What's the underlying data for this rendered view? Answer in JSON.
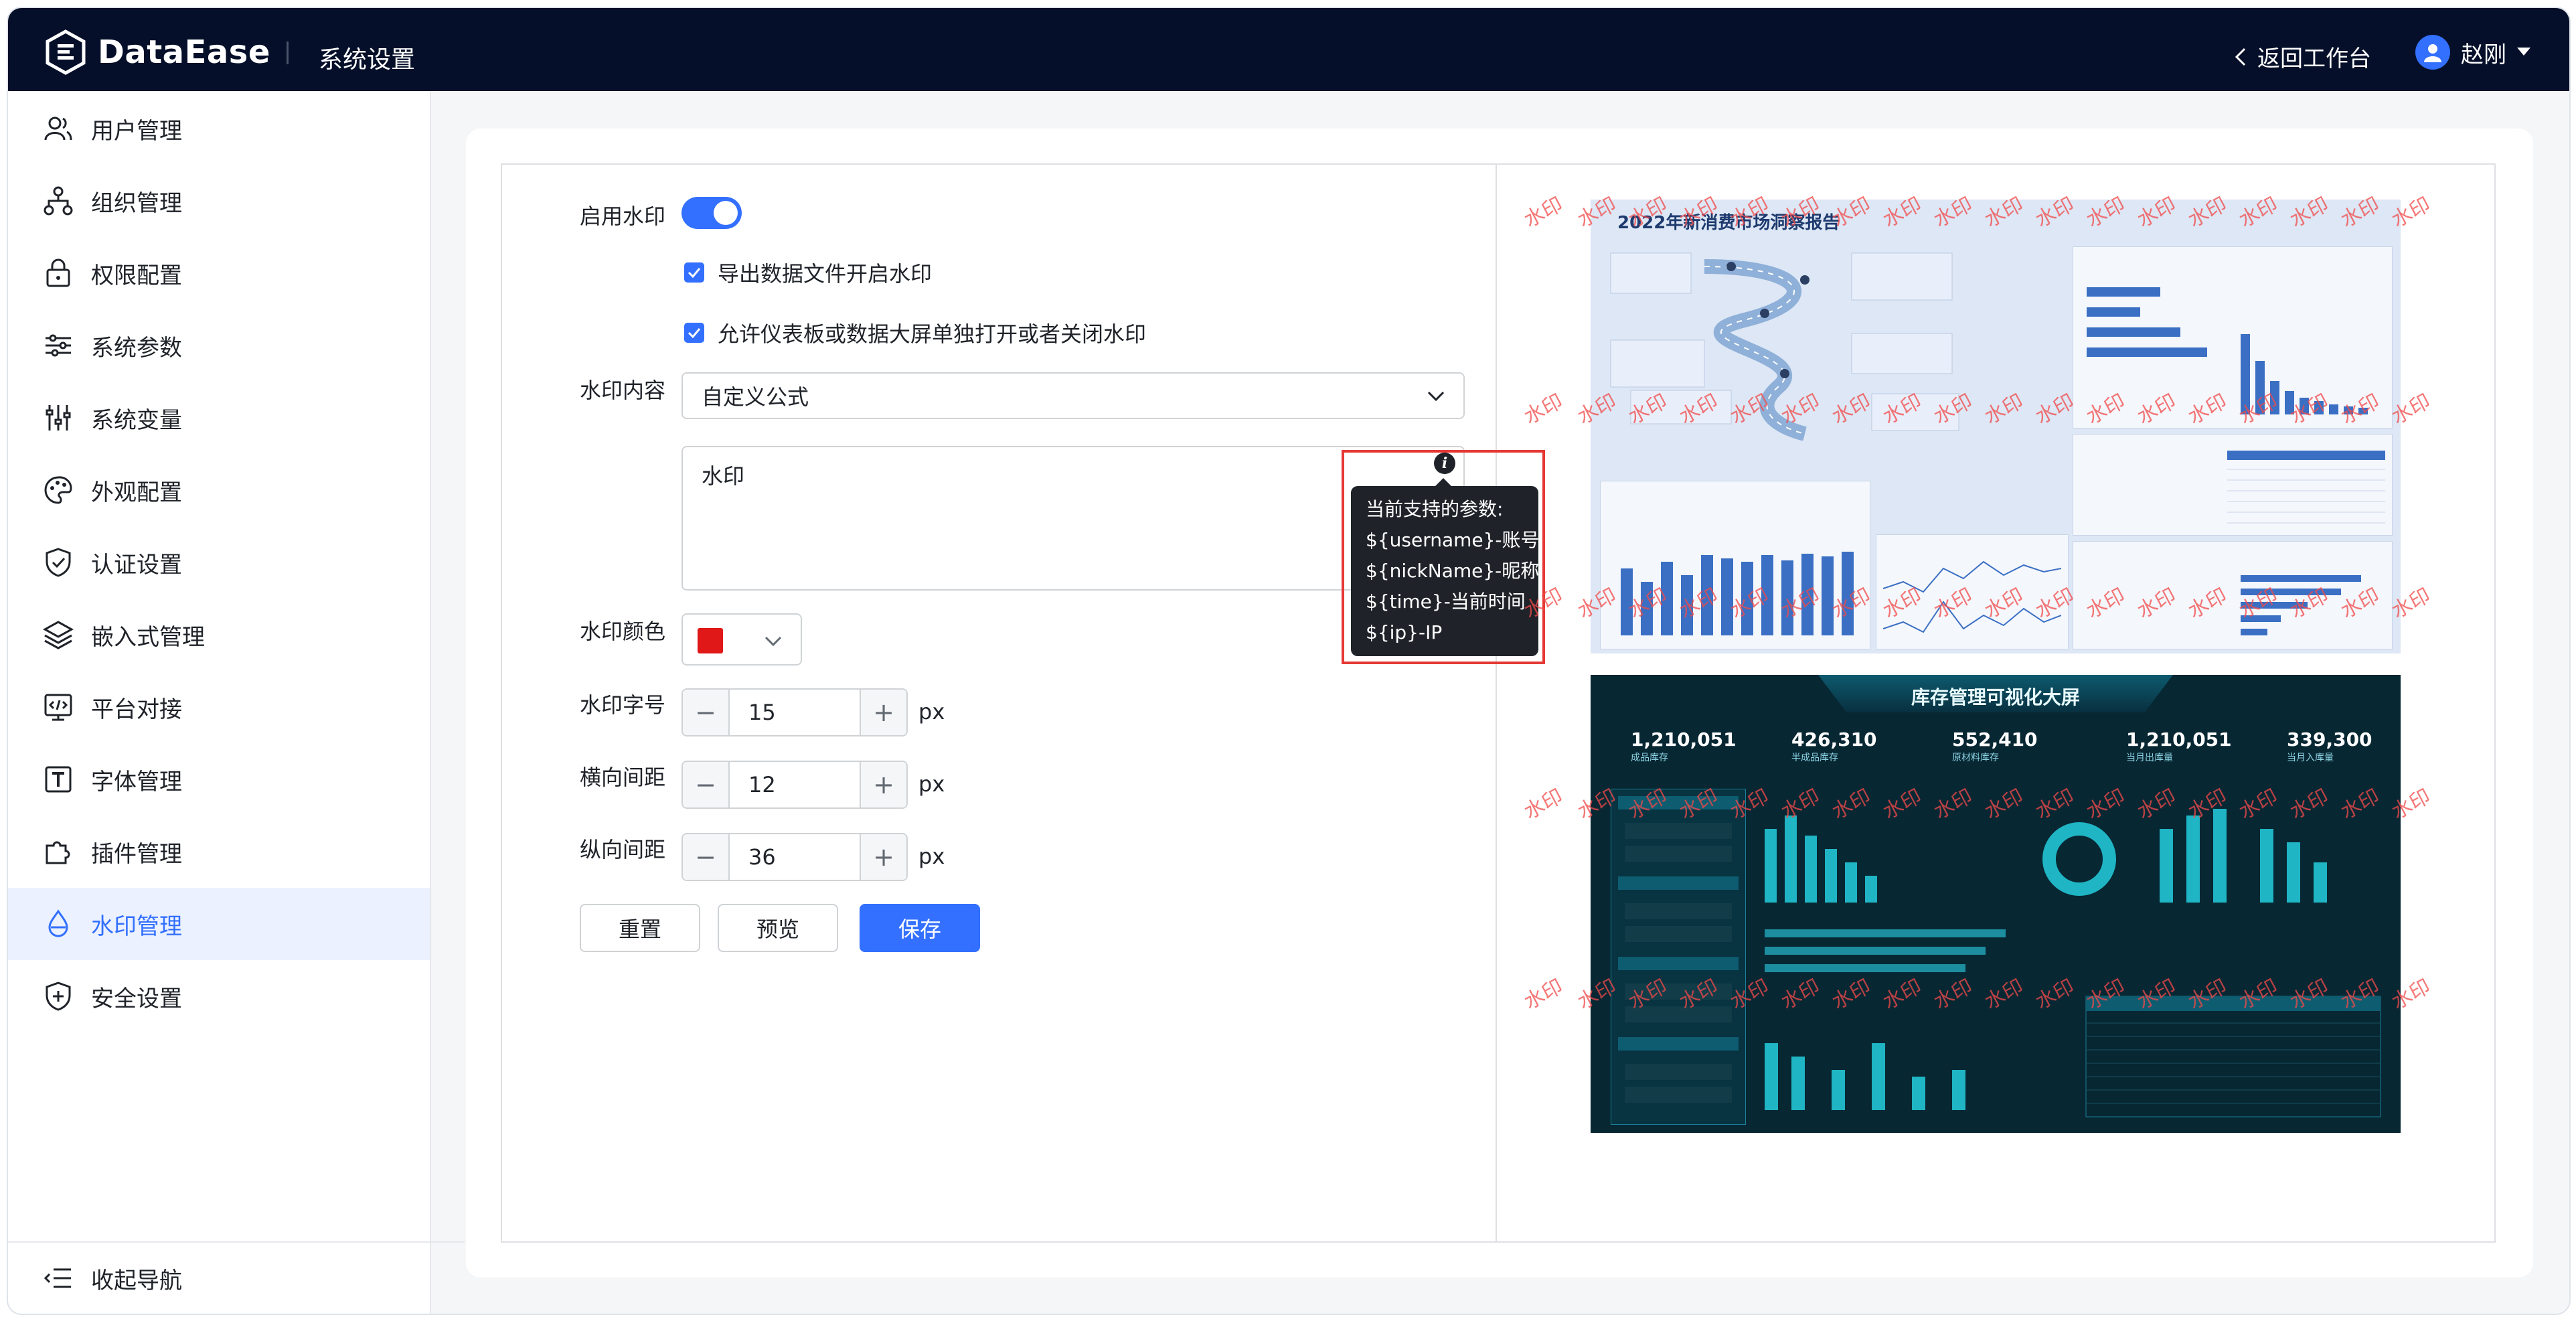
{
  "header": {
    "logo_text": "DataEase",
    "title": "系统设置",
    "back_label": "返回工作台",
    "user_name": "赵刚"
  },
  "sidebar": {
    "items": [
      {
        "label": "用户管理",
        "icon": "users-icon"
      },
      {
        "label": "组织管理",
        "icon": "org-tree-icon"
      },
      {
        "label": "权限配置",
        "icon": "lock-icon"
      },
      {
        "label": "系统参数",
        "icon": "sliders-icon"
      },
      {
        "label": "系统变量",
        "icon": "variables-icon"
      },
      {
        "label": "外观配置",
        "icon": "palette-icon"
      },
      {
        "label": "认证设置",
        "icon": "shield-check-icon"
      },
      {
        "label": "嵌入式管理",
        "icon": "layers-icon"
      },
      {
        "label": "平台对接",
        "icon": "code-window-icon"
      },
      {
        "label": "字体管理",
        "icon": "font-icon"
      },
      {
        "label": "插件管理",
        "icon": "puzzle-icon"
      },
      {
        "label": "水印管理",
        "icon": "droplet-icon",
        "active": true
      },
      {
        "label": "安全设置",
        "icon": "shield-plus-icon"
      }
    ],
    "collapse_label": "收起导航"
  },
  "form": {
    "enable_label": "启用水印",
    "enabled": true,
    "export_checkbox": {
      "label": "导出数据文件开启水印",
      "checked": true
    },
    "allow_checkbox": {
      "label": "允许仪表板或数据大屏单独打开或者关闭水印",
      "checked": true
    },
    "content_label": "水印内容",
    "content_type": "自定义公式",
    "content_text": "水印",
    "tooltip": {
      "title": "当前支持的参数:",
      "lines": [
        "${username}-账号",
        "${nickName}-昵称",
        "${time}-当前时间",
        "${ip}-IP"
      ]
    },
    "color_label": "水印颜色",
    "color_value": "#e01818",
    "font_size_label": "水印字号",
    "font_size": "15",
    "h_gap_label": "横向间距",
    "h_gap": "12",
    "v_gap_label": "纵向间距",
    "v_gap": "36",
    "unit": "px",
    "reset_label": "重置",
    "preview_label": "预览",
    "save_label": "保存"
  },
  "preview": {
    "watermark_text": "水印",
    "report_title": "2022年新消费市场洞察报告",
    "dashboard_title": "库存管理可视化大屏",
    "kpis": [
      {
        "value": "1,210,051",
        "caption": "成品库存"
      },
      {
        "value": "426,310",
        "caption": "半成品库存"
      },
      {
        "value": "552,410",
        "caption": "原材料库存"
      },
      {
        "value": "1,210,051",
        "caption": "当月出库量"
      },
      {
        "value": "339,300",
        "caption": "当月入库量"
      }
    ]
  },
  "colors": {
    "accent": "#3370ff",
    "header_bg": "#050f29",
    "highlight_border": "#e53935",
    "watermark": "#f24a4a"
  }
}
